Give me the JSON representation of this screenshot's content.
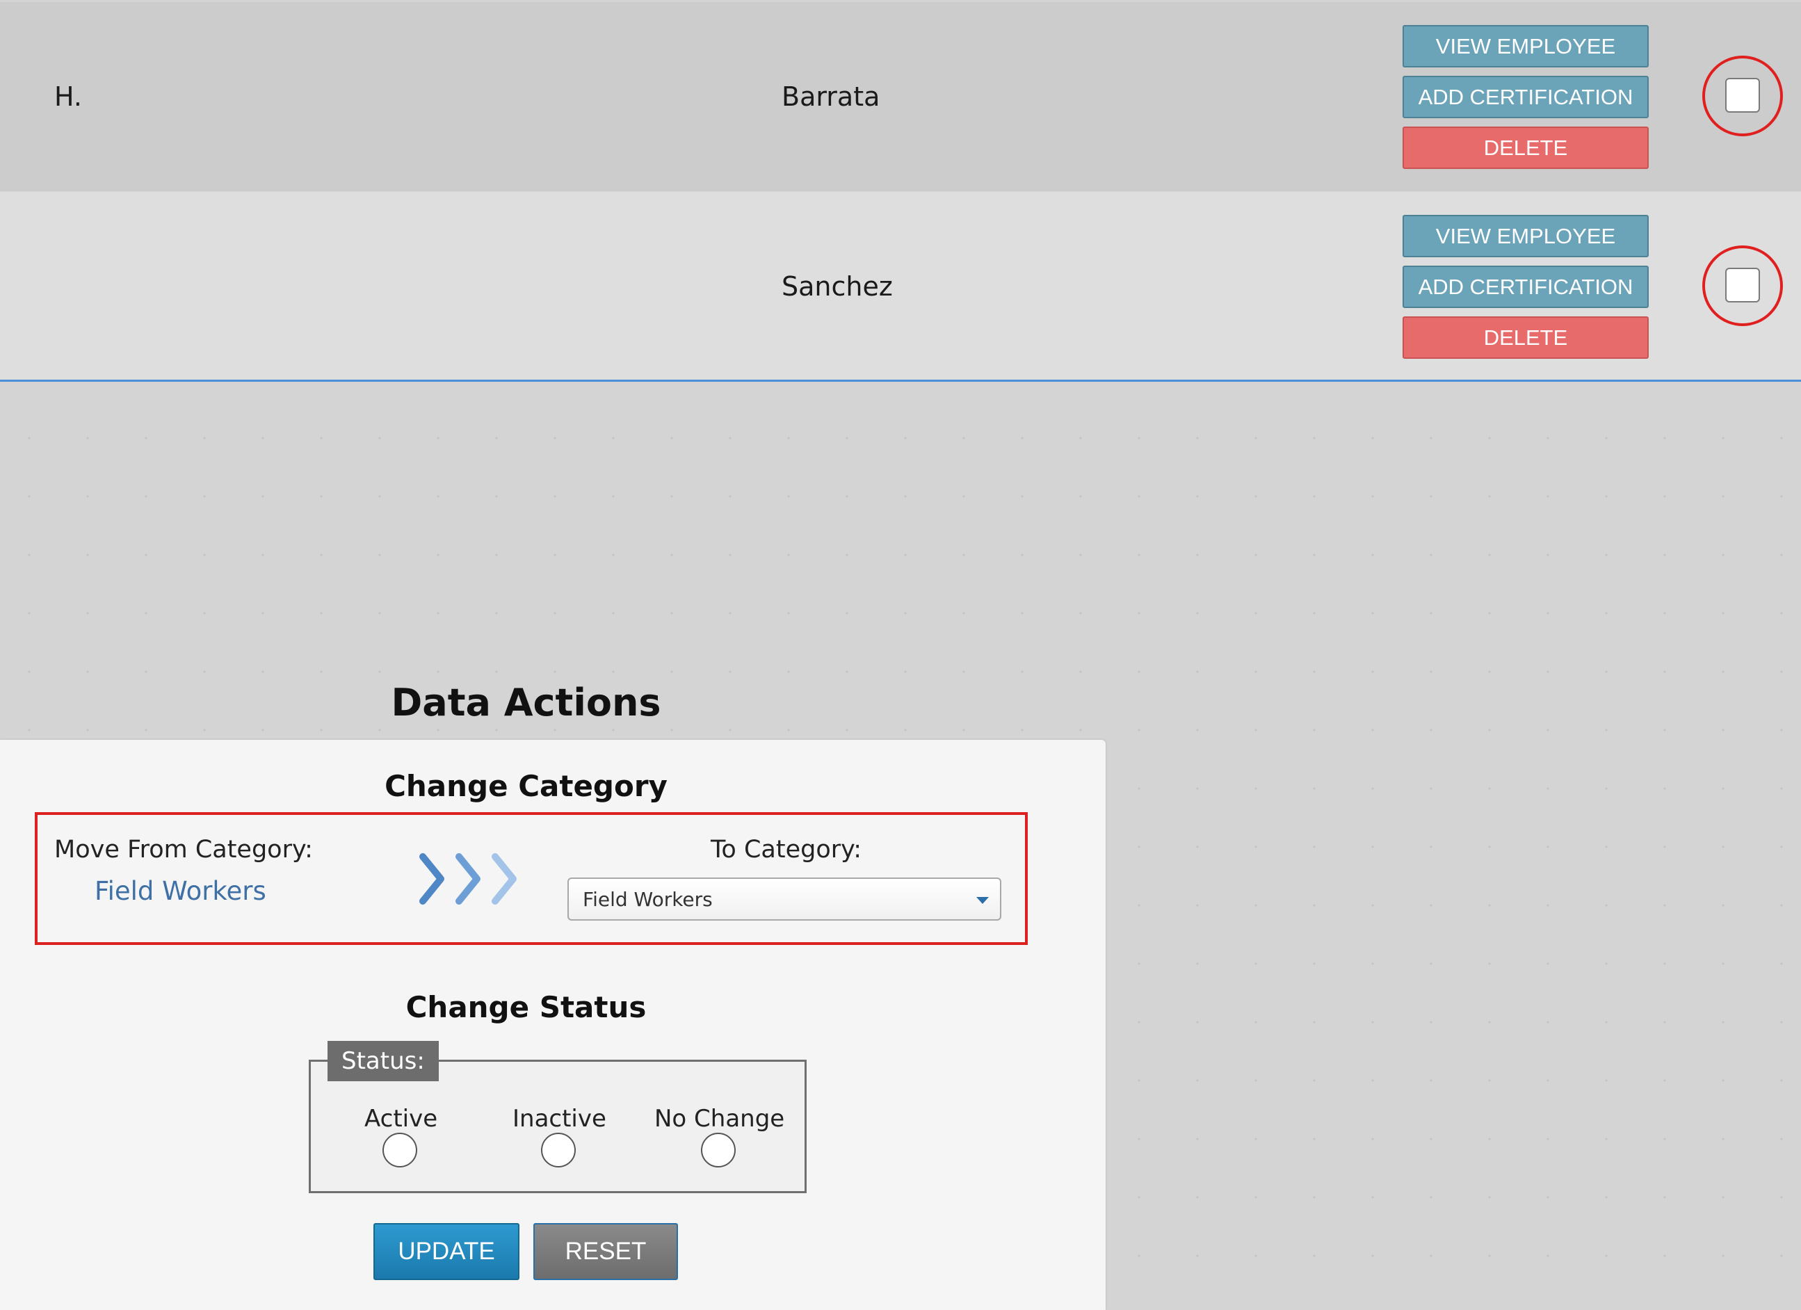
{
  "employees": [
    {
      "first_name": "H.",
      "last_name": "Barrata",
      "view_label": "VIEW EMPLOYEE",
      "cert_label": "ADD CERTIFICATION",
      "delete_label": "DELETE"
    },
    {
      "first_name": "",
      "last_name": "Sanchez",
      "view_label": "VIEW EMPLOYEE",
      "cert_label": "ADD CERTIFICATION",
      "delete_label": "DELETE"
    }
  ],
  "data_actions": {
    "title": "Data Actions",
    "change_category": {
      "heading": "Change Category",
      "from_label": "Move From Category:",
      "from_value": "Field Workers",
      "to_label": "To Category:",
      "to_value": "Field Workers"
    },
    "change_status": {
      "heading": "Change Status",
      "legend": "Status:",
      "options": [
        "Active",
        "Inactive",
        "No Change"
      ]
    },
    "update_label": "UPDATE",
    "reset_label": "RESET"
  },
  "colors": {
    "info_button": "#6ba3b8",
    "delete_button": "#e86b6b",
    "update_button": "#1b7aad",
    "reset_button": "#6d6d6d",
    "annotation_red": "#dc1f1f",
    "link_blue": "#3e70a6"
  }
}
